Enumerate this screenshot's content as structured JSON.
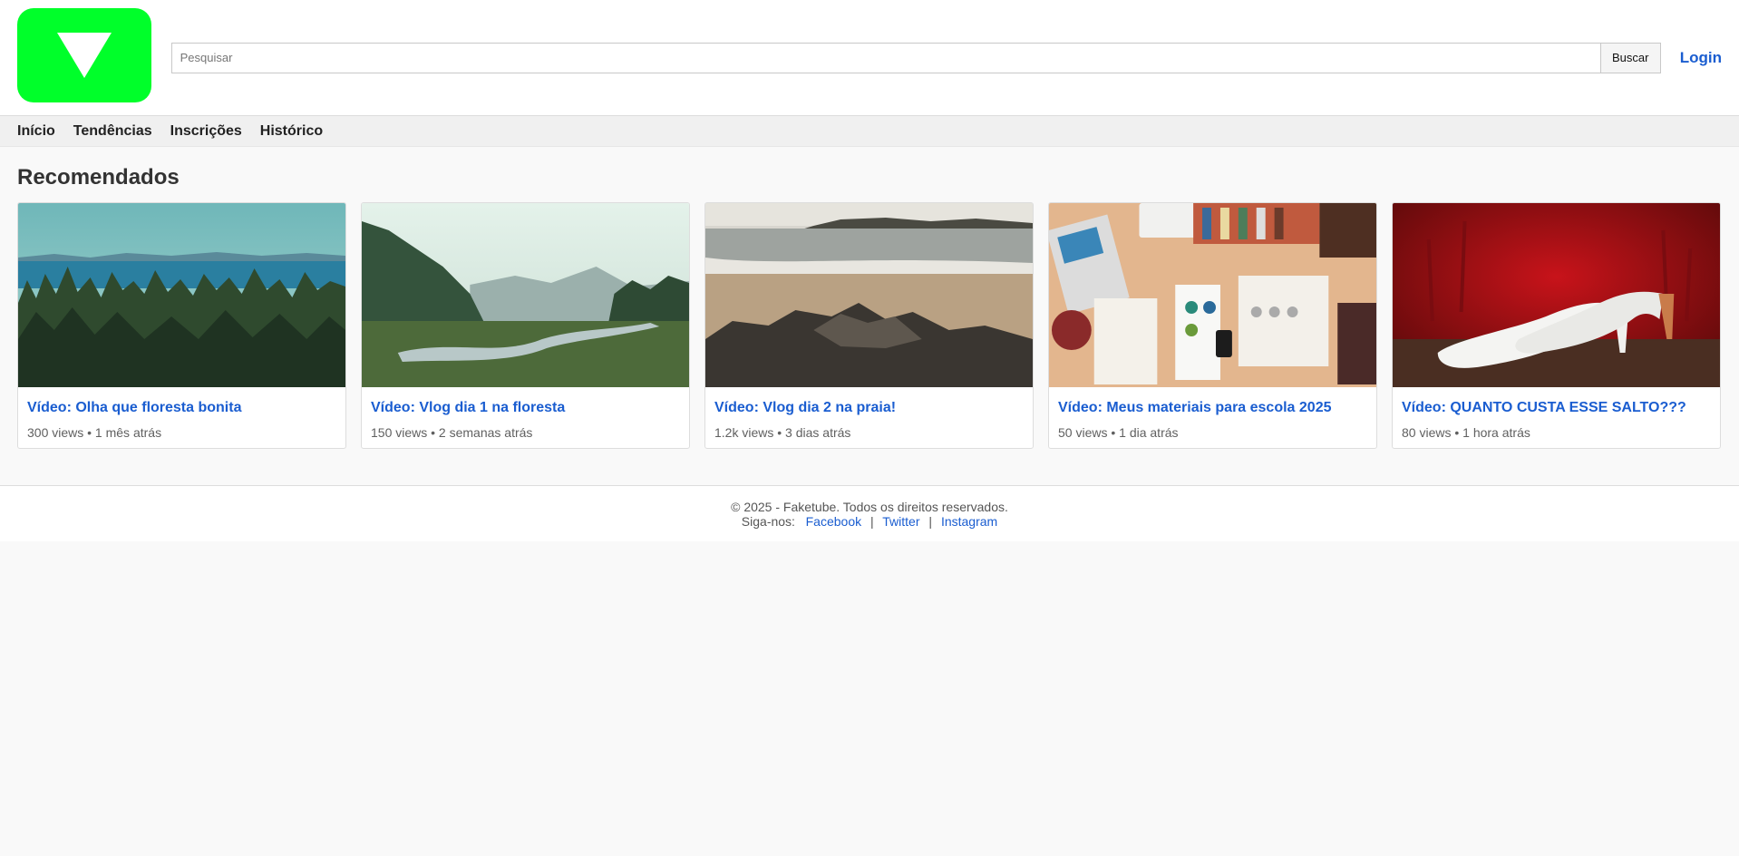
{
  "header": {
    "search_placeholder": "Pesquisar",
    "search_button": "Buscar",
    "login": "Login"
  },
  "nav": {
    "items": [
      "Início",
      "Tendências",
      "Inscrições",
      "Histórico"
    ]
  },
  "main": {
    "title": "Recomendados",
    "videos": [
      {
        "title": "Vídeo: Olha que floresta bonita",
        "meta": "300 views • 1 mês atrás",
        "thumb": "forest-lake"
      },
      {
        "title": "Vídeo: Vlog dia 1 na floresta",
        "meta": "150 views • 2 semanas atrás",
        "thumb": "river-valley"
      },
      {
        "title": "Vídeo: Vlog dia 2 na praia!",
        "meta": "1.2k views • 3 dias atrás",
        "thumb": "beach-rocks"
      },
      {
        "title": "Vídeo: Meus materiais para escola 2025",
        "meta": "50 views • 1 dia atrás",
        "thumb": "desk-supplies"
      },
      {
        "title": "Vídeo: QUANTO CUSTA ESSE SALTO???",
        "meta": "80 views • 1 hora atrás",
        "thumb": "white-heels"
      }
    ]
  },
  "footer": {
    "copyright": "© 2025 - Faketube. Todos os direitos reservados.",
    "follow": "Siga-nos:",
    "links": [
      "Facebook",
      "Twitter",
      "Instagram"
    ],
    "separator": "|"
  },
  "colors": {
    "brand": "#00ff2a",
    "link": "#1a5dd0"
  }
}
